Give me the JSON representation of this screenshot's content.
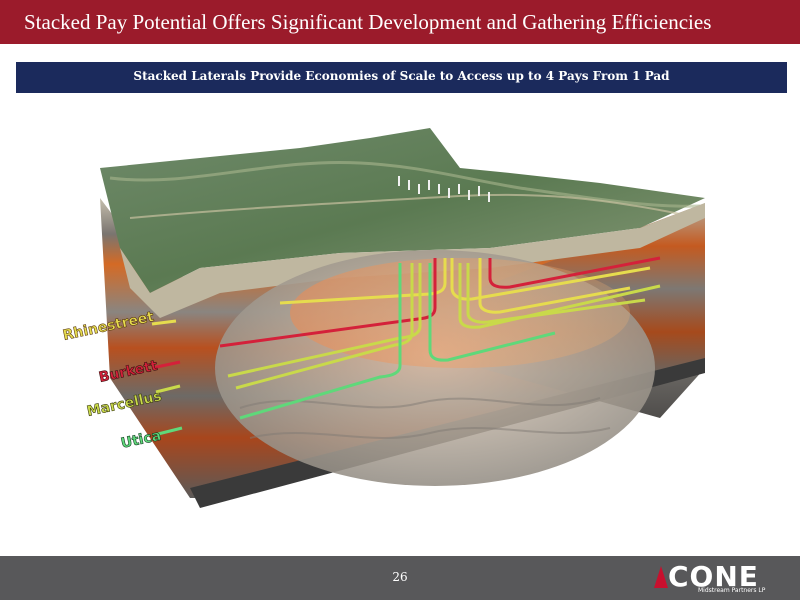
{
  "header": {
    "title": "Stacked Pay Potential Offers Significant Development and Gathering Efficiencies"
  },
  "banner": {
    "text": "Stacked Laterals Provide Economies of Scale to Access up to 4 Pays From 1 Pad"
  },
  "diagram": {
    "layers": [
      {
        "label": "Rhinestreet",
        "color": "#e6dc4e"
      },
      {
        "label": "Burkett",
        "color": "#d4213a"
      },
      {
        "label": "Marcellus",
        "color": "#c9d94a"
      },
      {
        "label": "Utica",
        "color": "#5fd87a"
      }
    ]
  },
  "footer": {
    "page_number": "26",
    "logo_word": "CONE",
    "logo_subtitle": "Midstream Partners LP"
  },
  "colors": {
    "title_bar": "#9b1b2b",
    "banner": "#1b2a5c",
    "footer": "#58585a"
  }
}
